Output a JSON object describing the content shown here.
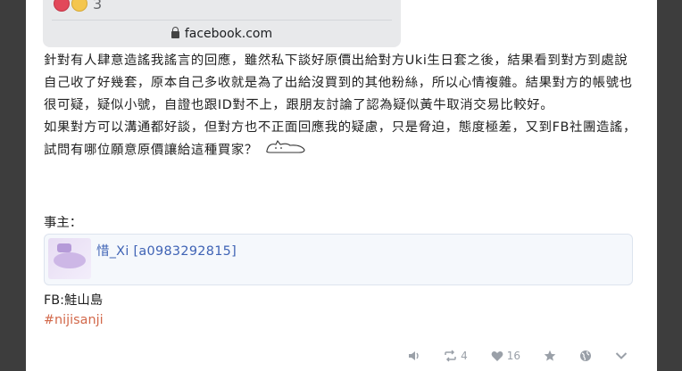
{
  "embed": {
    "reaction_count": "3",
    "domain": "facebook.com"
  },
  "post": {
    "paragraph1": "針對有人肆意造謠我謠言的回應，雖然私下談好原價出給對方Uki生日套之後，結果看到對方到處說自己收了好幾套，原本自己多收就是為了出給沒買到的其他粉絲，所以心情複雜。結果對方的帳號也很可疑，疑似小號，自證也跟ID對不上，跟朋友討論了認為疑似黃牛取消交易比較好。",
    "paragraph2": "如果對方可以溝通都好談，但對方也不正面回應我的疑慮，只是脅迫，態度極差，又到FB社團造謠，試問有哪位願意原價讓給這種買家？"
  },
  "owner_label": "事主：",
  "account": {
    "link_text": "惜_Xi [a0983292815]"
  },
  "fb_line": "FB:鮭山島",
  "hashtag": "#nijisanji",
  "actions": {
    "reblog_count": "4",
    "like_count": "16"
  }
}
